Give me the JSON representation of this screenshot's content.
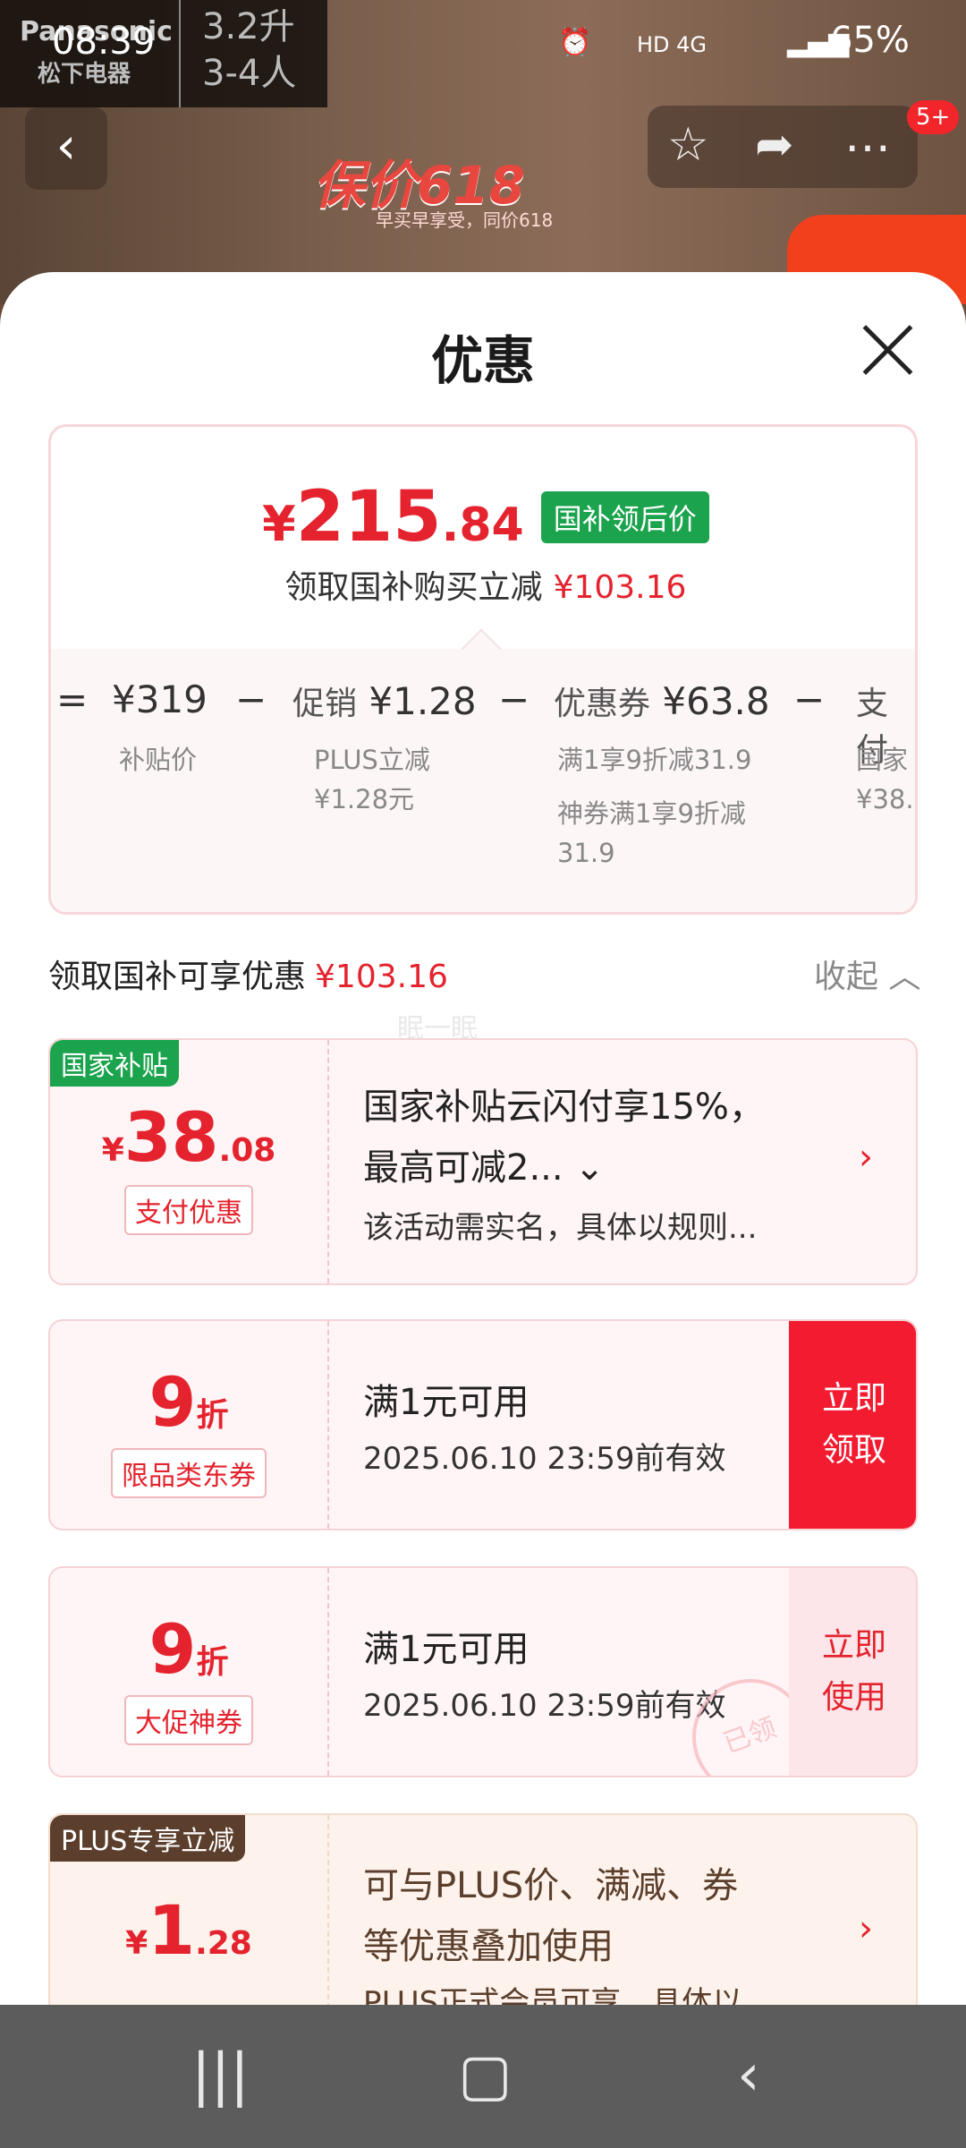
{
  "statusbar": {
    "time": "08:39",
    "network": "HD 4G",
    "battery": "65%"
  },
  "background": {
    "brand_line1": "Panasonic",
    "brand_line2": "松下电器",
    "spec_line1": "3.2升",
    "spec_line2": "3-4人",
    "promo_title": "保价618",
    "promo_sub": "早买早享受，同价618",
    "badge_count": "5+"
  },
  "sheet": {
    "title": "优惠",
    "price": {
      "currency": "¥",
      "integer": "215",
      "decimal": ".84",
      "tag": "国补领后价"
    },
    "save_text": "领取国补购买立减",
    "save_amount": "¥103.16",
    "calc": [
      {
        "op": "=",
        "value": "¥319",
        "sub": [
          "补贴价"
        ]
      },
      {
        "op": "−",
        "label": "促销",
        "value": "¥1.28",
        "sub": [
          "PLUS立减",
          "¥1.28元"
        ]
      },
      {
        "op": "−",
        "label": "优惠券",
        "value": "¥63.8",
        "sub": [
          "满1享9折减31.9",
          "神券满1享9折减",
          "31.9"
        ]
      },
      {
        "op": "−",
        "label": "支付",
        "sub": [
          "国家",
          "¥38."
        ]
      }
    ],
    "section_title": "领取国补可享优惠",
    "section_amount": "¥103.16",
    "collapse_label": "收起",
    "watermark": "眠一眠",
    "cards": [
      {
        "corner_tag": "国家补贴",
        "amount_symbol": "¥",
        "amount_int": "38",
        "amount_dec": ".08",
        "pill": "支付优惠",
        "line1": "国家补贴云闪付享15%，",
        "line2": "最高可减2...",
        "line3": "该活动需实名，具体以规则..."
      },
      {
        "amount_int": "9",
        "amount_unit": "折",
        "pill": "限品类东券",
        "line1": "满1元可用",
        "line2": "2025.06.10 23:59前有效",
        "button": [
          "立即",
          "领取"
        ]
      },
      {
        "amount_int": "9",
        "amount_unit": "折",
        "pill": "大促神券",
        "line1": "满1元可用",
        "line2": "2025.06.10 23:59前有效",
        "button": [
          "立即",
          "使用"
        ],
        "stamp": "已领"
      },
      {
        "corner_tag": "PLUS专享立减",
        "amount_symbol": "¥",
        "amount_int": "1",
        "amount_dec": ".28",
        "line1": "可与PLUS价、满减、券",
        "line2": "等优惠叠加使用",
        "line3": "PLUS正式会员可享，具体以"
      }
    ]
  },
  "colors": {
    "accent_red": "#e4232e",
    "green_tag": "#1ba34d",
    "button_red": "#f21b30"
  }
}
